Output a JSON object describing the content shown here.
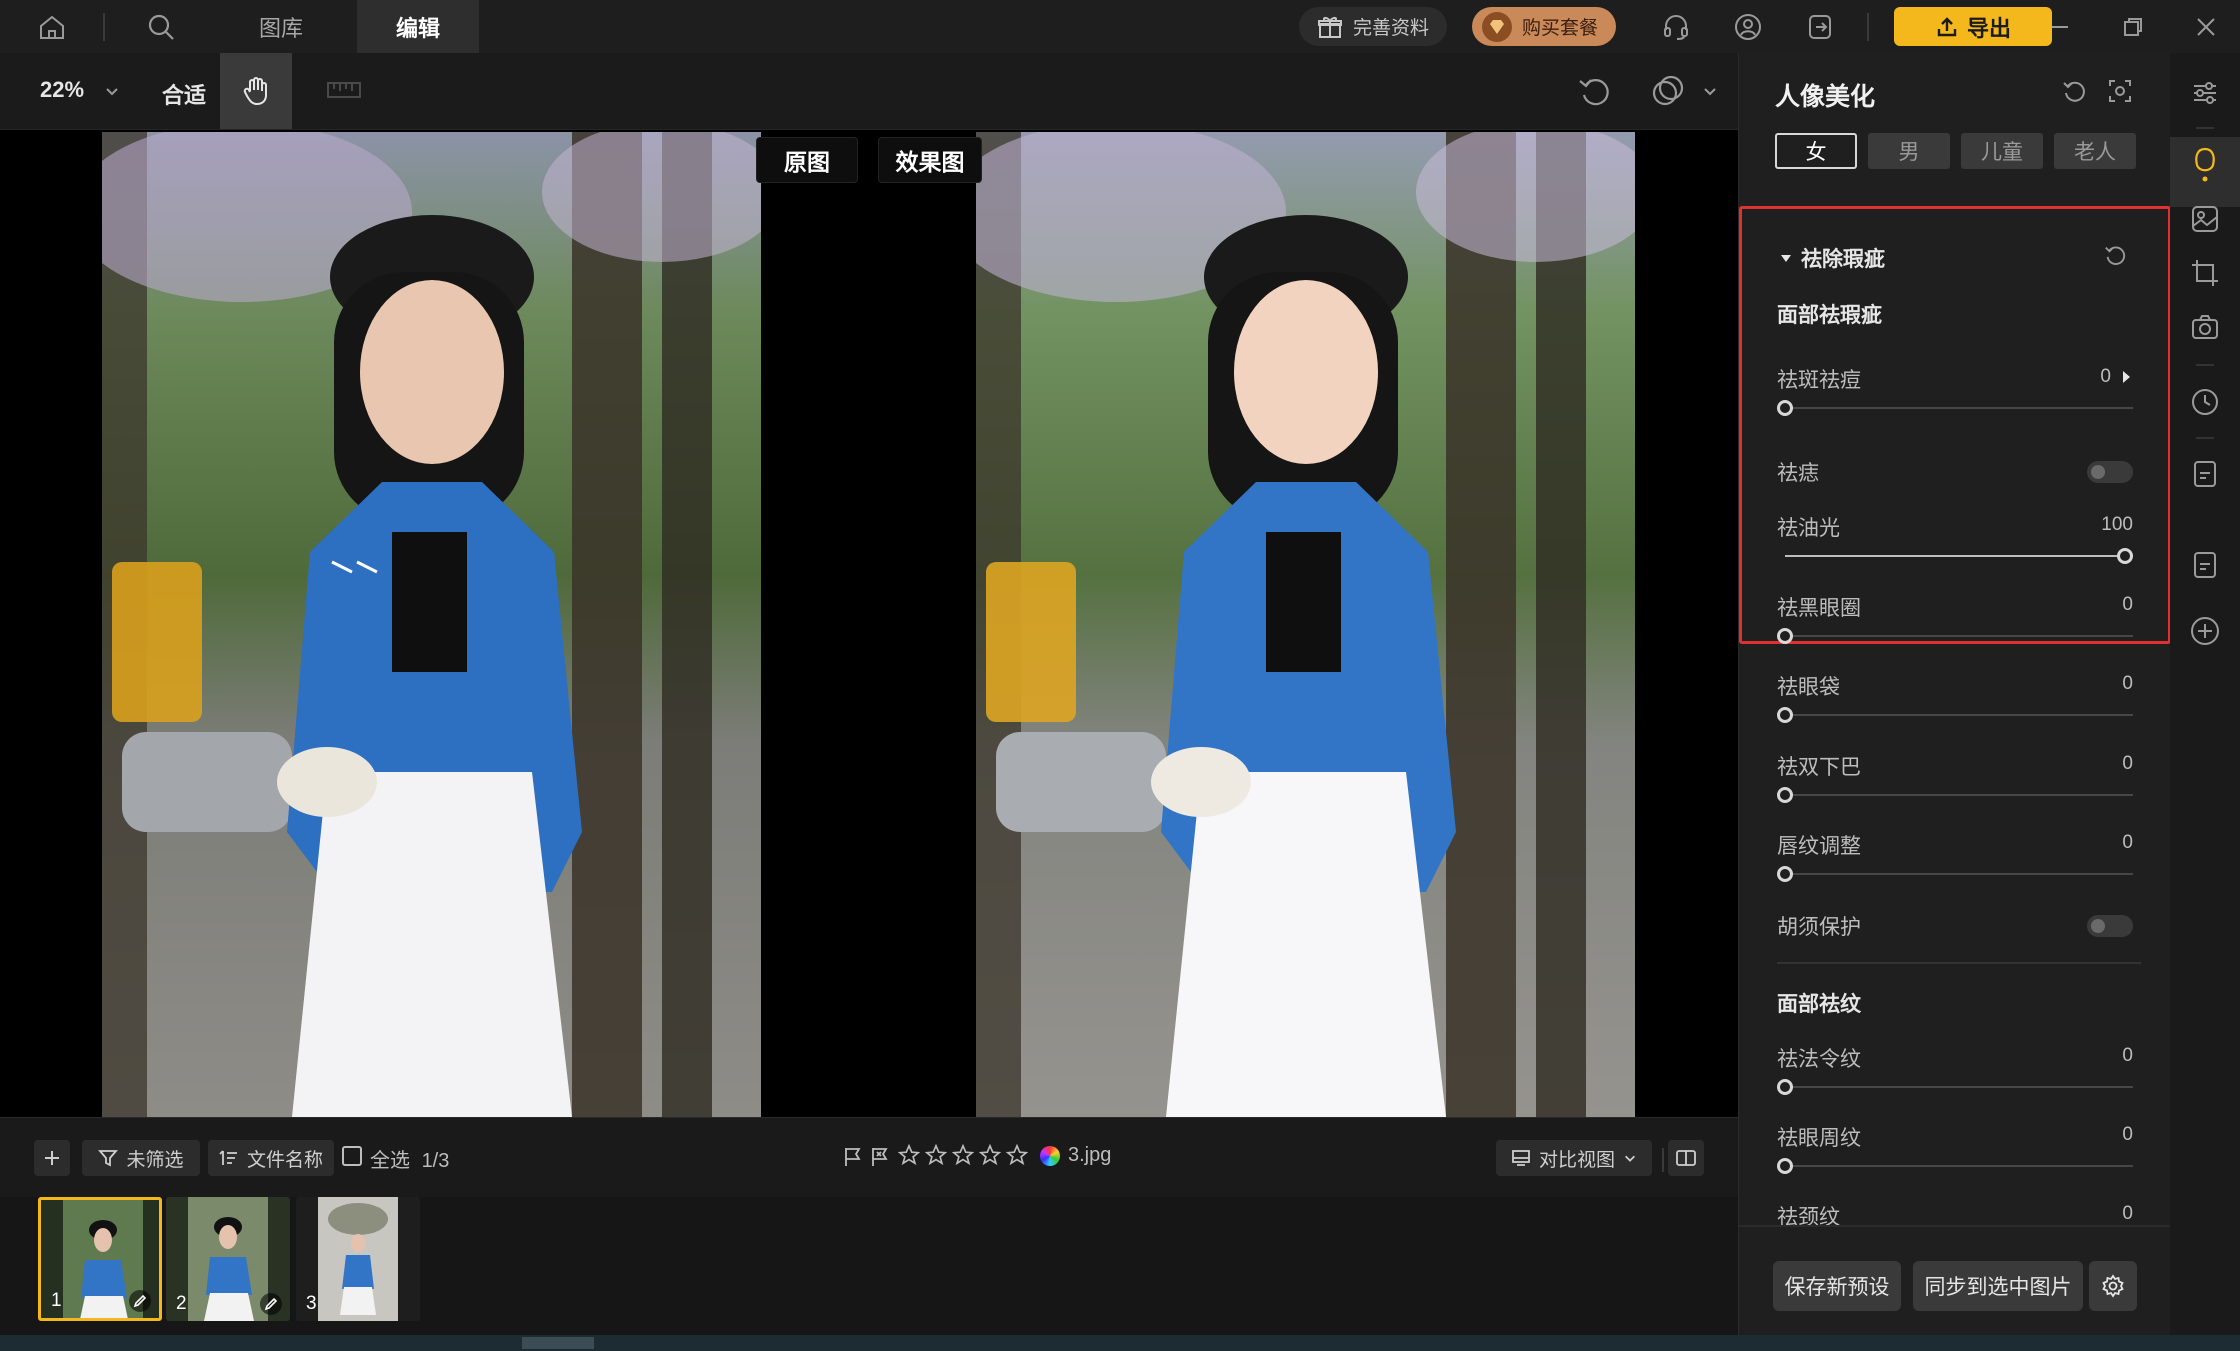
{
  "nav": {
    "tabs": [
      {
        "label": "图库"
      },
      {
        "label": "编辑"
      }
    ],
    "active_tab": "编辑",
    "complete_profile": "完善资料",
    "buy_package": "购买套餐",
    "export": "导出"
  },
  "toolbar": {
    "zoom": "22%",
    "fit": "合适"
  },
  "canvas": {
    "original_label": "原图",
    "effect_label": "效果图"
  },
  "bottombar": {
    "filter": "未筛选",
    "sort": "文件名称",
    "select_all": "全选",
    "selection_count": "1/3",
    "filename": "3.jpg",
    "view_mode": "对比视图",
    "rating_stars": 5
  },
  "filmstrip": {
    "thumbs": [
      {
        "num": "1"
      },
      {
        "num": "2"
      },
      {
        "num": "3"
      }
    ],
    "selected_index": 0
  },
  "panel": {
    "title": "人像美化",
    "genders": [
      "女",
      "男",
      "儿童",
      "老人"
    ],
    "active_gender": "女",
    "section_blemish": "祛除瑕疵",
    "group_face_blemish": "面部祛瑕疵",
    "items": {
      "spot": {
        "label": "祛斑祛痘",
        "value": "0"
      },
      "mole": {
        "label": "祛痣"
      },
      "oil": {
        "label": "祛油光",
        "value": "100"
      },
      "dark_circle": {
        "label": "祛黑眼圈",
        "value": "0"
      },
      "eye_bag": {
        "label": "祛眼袋",
        "value": "0"
      },
      "double_chin": {
        "label": "祛双下巴",
        "value": "0"
      },
      "lip_lines": {
        "label": "唇纹调整",
        "value": "0"
      },
      "beard": {
        "label": "胡须保护"
      }
    },
    "group_face_wrinkle": "面部祛纹",
    "wrinkles": {
      "nasolabial": {
        "label": "祛法令纹",
        "value": "0"
      },
      "eye_wrinkle": {
        "label": "祛眼周纹",
        "value": "0"
      },
      "neck": {
        "label": "祛颈纹",
        "value": "0"
      }
    },
    "save_preset": "保存新预设",
    "sync": "同步到选中图片"
  },
  "colors": {
    "accent_yellow": "#f5b81c",
    "highlight_red": "#e03131",
    "panel_bg": "#1f1f1f"
  }
}
